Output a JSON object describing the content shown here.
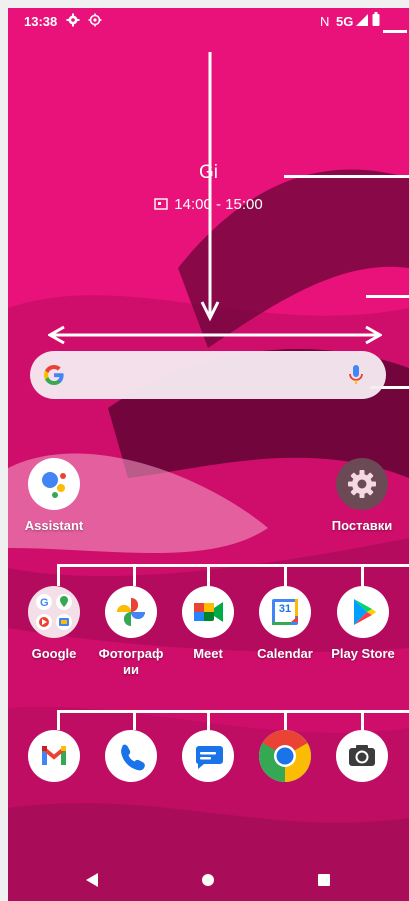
{
  "status_bar": {
    "time": "13:38",
    "left_icons": [
      "settings-gear-icon",
      "location-target-icon"
    ],
    "nfc": "N",
    "network": "5G",
    "right_icons": [
      "signal-icon",
      "battery-icon"
    ]
  },
  "event": {
    "title": "Gi",
    "time_range": "14:00 - 15:00",
    "icon": "calendar-icon"
  },
  "search": {
    "icons": [
      "google-g-icon",
      "microphone-icon"
    ]
  },
  "apps_top": [
    {
      "label": "Assistant",
      "icon": "assistant-icon"
    },
    {
      "label": "Поставки",
      "icon": "gear-icon"
    }
  ],
  "apps_row": [
    {
      "label": "Google",
      "icon": "google-folder-icon"
    },
    {
      "label": "Фотограф\nии",
      "icon": "photos-pinwheel-icon"
    },
    {
      "label": "Meet",
      "icon": "meet-camera-icon"
    },
    {
      "label": "Calendar",
      "icon": "calendar-31-icon",
      "day": "31"
    },
    {
      "label": "Play Store",
      "icon": "play-triangle-icon"
    }
  ],
  "dock": [
    {
      "icon": "gmail-icon"
    },
    {
      "icon": "phone-icon"
    },
    {
      "icon": "messages-icon"
    },
    {
      "icon": "chrome-icon"
    },
    {
      "icon": "camera-icon"
    }
  ],
  "navigation": {
    "icons": [
      "back-triangle-icon",
      "home-circle-icon",
      "recents-square-icon"
    ]
  },
  "colors": {
    "wallpaper_accent": "#e8127a",
    "wallpaper_dark": "#5a0630",
    "search_bar": "#f5ecf2"
  }
}
